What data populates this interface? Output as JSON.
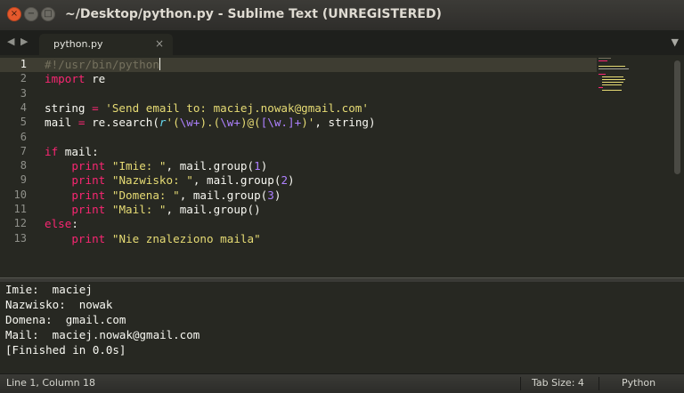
{
  "window": {
    "title": "~/Desktop/python.py - Sublime Text (UNREGISTERED)",
    "close_glyph": "×",
    "minimize_glyph": "−",
    "maximize_glyph": "□"
  },
  "tabbar": {
    "back_glyph": "◀",
    "forward_glyph": "▶",
    "tabs": [
      {
        "label": "python.py",
        "close_glyph": "×",
        "active": true
      }
    ],
    "dropdown_glyph": "▼"
  },
  "editor": {
    "current_line": 1,
    "line_numbers": [
      "1",
      "2",
      "3",
      "4",
      "5",
      "6",
      "7",
      "8",
      "9",
      "10",
      "11",
      "12",
      "13"
    ],
    "lines": [
      [
        {
          "t": "#!/usr/bin/python",
          "c": "cmt"
        }
      ],
      [
        {
          "t": "import",
          "c": "kw"
        },
        {
          "t": " re",
          "c": ""
        }
      ],
      [],
      [
        {
          "t": "string ",
          "c": ""
        },
        {
          "t": "=",
          "c": "kw"
        },
        {
          "t": " ",
          "c": ""
        },
        {
          "t": "'Send email to: maciej.nowak@gmail.com'",
          "c": "str"
        }
      ],
      [
        {
          "t": "mail ",
          "c": ""
        },
        {
          "t": "=",
          "c": "kw"
        },
        {
          "t": " re.search(",
          "c": ""
        },
        {
          "t": "r",
          "c": "fn"
        },
        {
          "t": "'(",
          "c": "str"
        },
        {
          "t": "\\w+",
          "c": "rx"
        },
        {
          "t": ").(",
          "c": "str"
        },
        {
          "t": "\\w+",
          "c": "rx"
        },
        {
          "t": ")@(",
          "c": "str"
        },
        {
          "t": "[\\w.]+",
          "c": "rx"
        },
        {
          "t": ")'",
          "c": "str"
        },
        {
          "t": ", string)",
          "c": ""
        }
      ],
      [],
      [
        {
          "t": "if",
          "c": "kw"
        },
        {
          "t": " mail:",
          "c": ""
        }
      ],
      [
        {
          "t": "    ",
          "c": ""
        },
        {
          "t": "print",
          "c": "kw"
        },
        {
          "t": " ",
          "c": ""
        },
        {
          "t": "\"Imie: \"",
          "c": "str"
        },
        {
          "t": ", mail.group(",
          "c": ""
        },
        {
          "t": "1",
          "c": "num"
        },
        {
          "t": ")",
          "c": ""
        }
      ],
      [
        {
          "t": "    ",
          "c": ""
        },
        {
          "t": "print",
          "c": "kw"
        },
        {
          "t": " ",
          "c": ""
        },
        {
          "t": "\"Nazwisko: \"",
          "c": "str"
        },
        {
          "t": ", mail.group(",
          "c": ""
        },
        {
          "t": "2",
          "c": "num"
        },
        {
          "t": ")",
          "c": ""
        }
      ],
      [
        {
          "t": "    ",
          "c": ""
        },
        {
          "t": "print",
          "c": "kw"
        },
        {
          "t": " ",
          "c": ""
        },
        {
          "t": "\"Domena: \"",
          "c": "str"
        },
        {
          "t": ", mail.group(",
          "c": ""
        },
        {
          "t": "3",
          "c": "num"
        },
        {
          "t": ")",
          "c": ""
        }
      ],
      [
        {
          "t": "    ",
          "c": ""
        },
        {
          "t": "print",
          "c": "kw"
        },
        {
          "t": " ",
          "c": ""
        },
        {
          "t": "\"Mail: \"",
          "c": "str"
        },
        {
          "t": ", mail.group()",
          "c": ""
        }
      ],
      [
        {
          "t": "else",
          "c": "kw"
        },
        {
          "t": ":",
          "c": ""
        }
      ],
      [
        {
          "t": "    ",
          "c": ""
        },
        {
          "t": "print",
          "c": "kw"
        },
        {
          "t": " ",
          "c": ""
        },
        {
          "t": "\"Nie znaleziono maila\"",
          "c": "str"
        }
      ]
    ]
  },
  "output": {
    "lines": [
      "Imie:  maciej",
      "Nazwisko:  nowak",
      "Domena:  gmail.com",
      "Mail:  maciej.nowak@gmail.com",
      "[Finished in 0.0s]"
    ]
  },
  "statusbar": {
    "position": "Line 1, Column 18",
    "tab_size": "Tab Size: 4",
    "syntax": "Python"
  },
  "colors": {
    "background": "#272822",
    "keyword": "#f92672",
    "string": "#e6db74",
    "number": "#ae81ff",
    "comment": "#75715e",
    "function": "#66d9ef",
    "close_button": "#e5592c"
  }
}
